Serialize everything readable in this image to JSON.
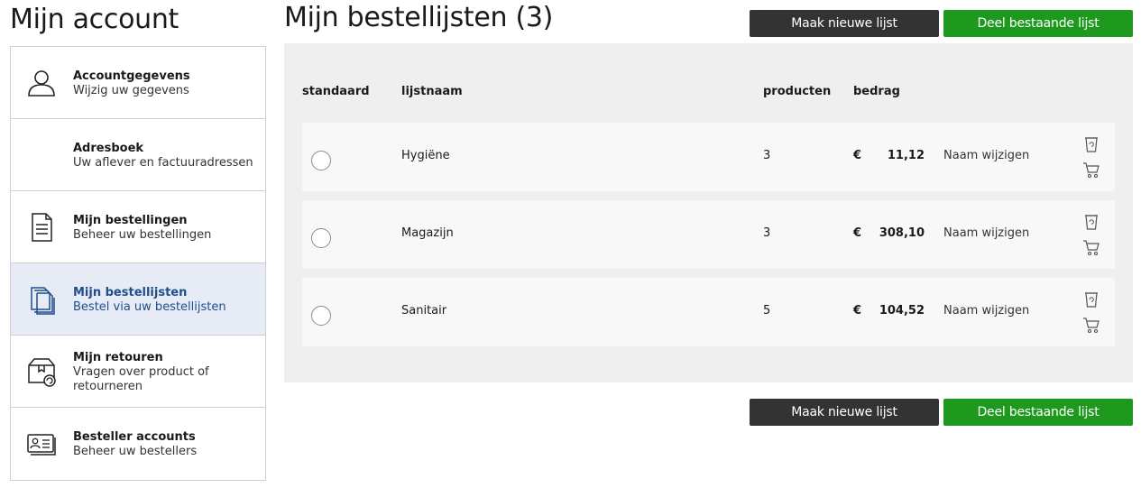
{
  "sidebar": {
    "title": "Mijn account",
    "items": [
      {
        "title": "Accountgegevens",
        "subtitle": "Wijzig uw gegevens",
        "icon": "user-icon"
      },
      {
        "title": "Adresboek",
        "subtitle": "Uw aflever en factuuradressen",
        "icon": ""
      },
      {
        "title": "Mijn bestellingen",
        "subtitle": "Beheer uw bestellingen",
        "icon": "document-list-icon"
      },
      {
        "title": "Mijn bestellijsten",
        "subtitle": "Bestel via uw bestellijsten",
        "icon": "stacked-pages-icon",
        "active": true
      },
      {
        "title": "Mijn retouren",
        "subtitle": "Vragen over product of retourneren",
        "icon": "return-box-icon"
      },
      {
        "title": "Besteller accounts",
        "subtitle": "Beheer uw bestellers",
        "icon": "id-card-icon"
      }
    ]
  },
  "main": {
    "title": "Mijn bestellijsten (3)",
    "buttons": {
      "new_list": "Maak nieuwe lijst",
      "share_list": "Deel bestaande lijst"
    },
    "table": {
      "headers": {
        "default": "standaard",
        "name": "lijstnaam",
        "products": "producten",
        "amount": "bedrag"
      },
      "rows": [
        {
          "name": "Hygiëne",
          "products": "3",
          "currency": "€",
          "amount": "11,12",
          "rename": "Naam wijzigen"
        },
        {
          "name": "Magazijn",
          "products": "3",
          "currency": "€",
          "amount": "308,10",
          "rename": "Naam wijzigen"
        },
        {
          "name": "Sanitair",
          "products": "5",
          "currency": "€",
          "amount": "104,52",
          "rename": "Naam wijzigen"
        }
      ]
    }
  },
  "colors": {
    "dark_button": "#333333",
    "green_button": "#1d9a1d",
    "active_sidebar": "#e6ebf5",
    "active_text": "#1f4e8c",
    "panel_bg": "#efefef"
  }
}
